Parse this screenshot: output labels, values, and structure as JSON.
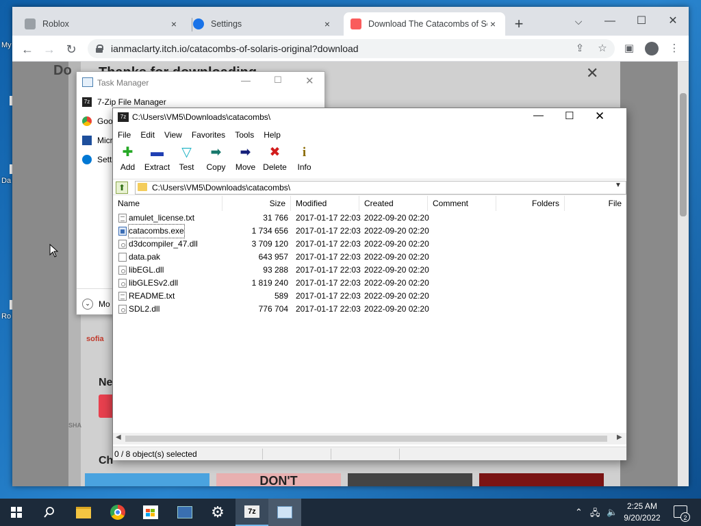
{
  "desktop": {
    "labels": [
      "My",
      "Da",
      "Ro"
    ]
  },
  "chrome": {
    "tabs": [
      {
        "label": "Roblox",
        "close": "×"
      },
      {
        "label": "Settings",
        "close": "×"
      },
      {
        "label": "Download The Catacombs of Solaris",
        "close": "×"
      }
    ],
    "new_tab": "+",
    "url": "ianmaclarty.itch.io/catacombs-of-solaris-original?download",
    "window_controls": {
      "minimize": "—",
      "maximize": "☐",
      "close": "✕"
    }
  },
  "page": {
    "title_partial": "Do",
    "modal_title_partial": "Thanks for downloading",
    "modal_close": "✕",
    "section_new": "Ne",
    "section_ch": "Ch",
    "share_label": "SHA",
    "ad_logo": "sofia",
    "ad_thumb_text": "DON'T"
  },
  "task_manager": {
    "title": "Task Manager",
    "rows": [
      {
        "label": "7-Zip File Manager",
        "icon": "7z"
      },
      {
        "label": "Goo",
        "icon": "chrome"
      },
      {
        "label": "Micr",
        "icon": "app"
      },
      {
        "label": "Setti",
        "icon": "gear"
      }
    ],
    "more_label": "Mo"
  },
  "sevenzip": {
    "title": "C:\\Users\\VM5\\Downloads\\catacombs\\",
    "menu": [
      "File",
      "Edit",
      "View",
      "Favorites",
      "Tools",
      "Help"
    ],
    "tools": [
      {
        "label": "Add",
        "icon": "add-icon"
      },
      {
        "label": "Extract",
        "icon": "extract-icon"
      },
      {
        "label": "Test",
        "icon": "test-icon"
      },
      {
        "label": "Copy",
        "icon": "copy-icon"
      },
      {
        "label": "Move",
        "icon": "move-icon"
      },
      {
        "label": "Delete",
        "icon": "delete-icon"
      },
      {
        "label": "Info",
        "icon": "info-icon"
      }
    ],
    "path": "C:\\Users\\VM5\\Downloads\\catacombs\\",
    "columns": [
      "Name",
      "Size",
      "Modified",
      "Created",
      "Comment",
      "Folders",
      "File"
    ],
    "files": [
      {
        "name": "amulet_license.txt",
        "size": "31 766",
        "modified": "2017-01-17 22:03",
        "created": "2022-09-20 02:20",
        "type": "txt"
      },
      {
        "name": "catacombs.exe",
        "size": "1 734 656",
        "modified": "2017-01-17 22:03",
        "created": "2022-09-20 02:20",
        "type": "exe"
      },
      {
        "name": "d3dcompiler_47.dll",
        "size": "3 709 120",
        "modified": "2017-01-17 22:03",
        "created": "2022-09-20 02:20",
        "type": "dll"
      },
      {
        "name": "data.pak",
        "size": "643 957",
        "modified": "2017-01-17 22:03",
        "created": "2022-09-20 02:20",
        "type": "file"
      },
      {
        "name": "libEGL.dll",
        "size": "93 288",
        "modified": "2017-01-17 22:03",
        "created": "2022-09-20 02:20",
        "type": "dll"
      },
      {
        "name": "libGLESv2.dll",
        "size": "1 819 240",
        "modified": "2017-01-17 22:03",
        "created": "2022-09-20 02:20",
        "type": "dll"
      },
      {
        "name": "README.txt",
        "size": "589",
        "modified": "2017-01-17 22:03",
        "created": "2022-09-20 02:20",
        "type": "txt"
      },
      {
        "name": "SDL2.dll",
        "size": "776 704",
        "modified": "2017-01-17 22:03",
        "created": "2022-09-20 02:20",
        "type": "dll"
      }
    ],
    "status": "0 / 8 object(s) selected"
  },
  "taskbar": {
    "time": "2:25 AM",
    "date": "9/20/2022",
    "notification_count": "2"
  }
}
